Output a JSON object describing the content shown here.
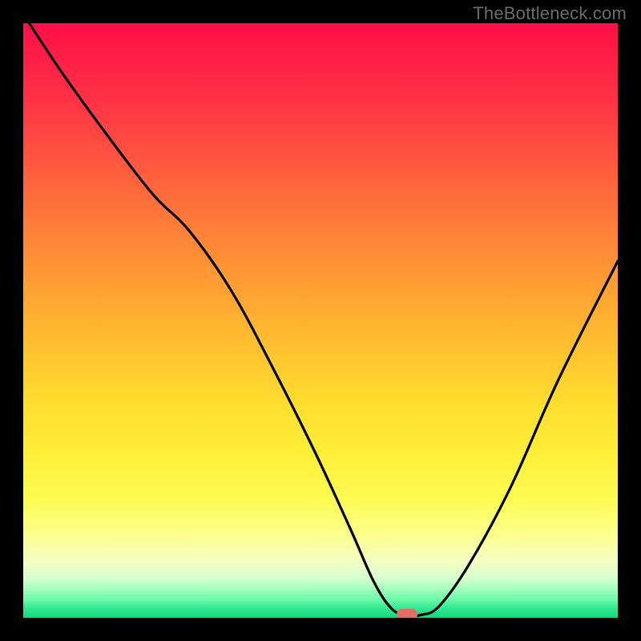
{
  "watermark": "TheBottleneck.com",
  "colors": {
    "frame_bg": "#000000",
    "curve_stroke": "#000000",
    "marker_fill": "#e37067",
    "watermark_text": "#6c6c6c"
  },
  "chart_data": {
    "type": "line",
    "title": "",
    "xlabel": "",
    "ylabel": "",
    "xlim": [
      0,
      100
    ],
    "ylim": [
      0,
      100
    ],
    "series": [
      {
        "name": "bottleneck-curve",
        "x": [
          1,
          7,
          15,
          22,
          28,
          35,
          42,
          49,
          55,
          59,
          62,
          64.5,
          67,
          70,
          75,
          82,
          90,
          100
        ],
        "values": [
          100,
          91,
          80,
          71,
          65,
          55,
          42,
          28,
          15,
          6,
          1.5,
          0.5,
          0.5,
          2,
          9,
          22,
          40,
          60
        ]
      }
    ],
    "marker": {
      "x": 64.5,
      "y": 0.5
    },
    "background_gradient": {
      "top": "#ff0f47",
      "mid": "#ffee38",
      "bottom": "#16d67c"
    }
  }
}
